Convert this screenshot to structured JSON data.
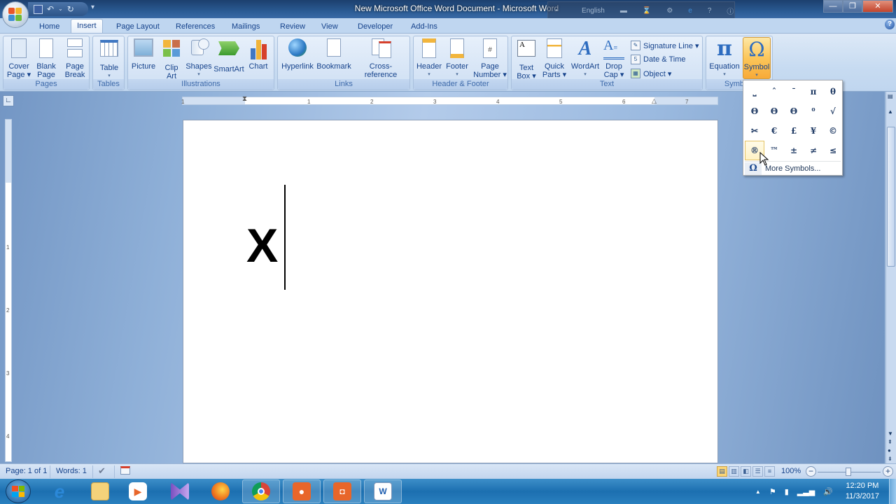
{
  "window": {
    "title": "New Microsoft Office Word Document  -  Microsoft Word",
    "ime_language": "English",
    "controls": {
      "minimize": "—",
      "restore": "❐",
      "close": "✕"
    }
  },
  "qat": {
    "save": "💾",
    "undo": "↶",
    "redo": "↻",
    "customize": "▾"
  },
  "tabs": [
    {
      "label": "Home",
      "active": false
    },
    {
      "label": "Insert",
      "active": true
    },
    {
      "label": "Page Layout",
      "active": false
    },
    {
      "label": "References",
      "active": false
    },
    {
      "label": "Mailings",
      "active": false
    },
    {
      "label": "Review",
      "active": false
    },
    {
      "label": "View",
      "active": false
    },
    {
      "label": "Developer",
      "active": false
    },
    {
      "label": "Add-Ins",
      "active": false
    }
  ],
  "ribbon": {
    "groups": {
      "pages": "Pages",
      "tables": "Tables",
      "illustrations": "Illustrations",
      "links": "Links",
      "header_footer": "Header & Footer",
      "text": "Text",
      "symbols": "Symbols"
    },
    "buttons": {
      "cover_page": [
        "Cover",
        "Page ▾"
      ],
      "blank_page": [
        "Blank",
        "Page"
      ],
      "page_break": [
        "Page",
        "Break"
      ],
      "table": [
        "Table",
        "▾"
      ],
      "picture": [
        "Picture",
        ""
      ],
      "clip_art": [
        "Clip",
        "Art"
      ],
      "shapes": [
        "Shapes",
        "▾"
      ],
      "smartart": [
        "SmartArt",
        ""
      ],
      "chart": [
        "Chart",
        ""
      ],
      "hyperlink": [
        "Hyperlink",
        ""
      ],
      "bookmark": [
        "Bookmark",
        ""
      ],
      "cross_reference": [
        "Cross-reference",
        ""
      ],
      "header": [
        "Header",
        "▾"
      ],
      "footer": [
        "Footer",
        "▾"
      ],
      "page_number": [
        "Page",
        "Number ▾"
      ],
      "text_box": [
        "Text",
        "Box ▾"
      ],
      "quick_parts": [
        "Quick",
        "Parts ▾"
      ],
      "wordart": [
        "WordArt",
        "▾"
      ],
      "drop_cap": [
        "Drop",
        "Cap ▾"
      ],
      "equation": [
        "Equation",
        "▾"
      ],
      "symbol": [
        "Symbol",
        "▾"
      ]
    },
    "small_buttons": {
      "signature_line": "Signature Line ▾",
      "date_time": "Date & Time",
      "object": "Object ▾"
    }
  },
  "symbol_menu": {
    "symbols": [
      "⎵",
      "ˆ",
      "¯",
      "π",
      "θ",
      "Θ",
      "Θ",
      "Θ",
      "⁰",
      "√",
      "✂",
      "€",
      "£",
      "¥",
      "©",
      "®",
      "™",
      "±",
      "≠",
      "≤"
    ],
    "hovered_index": 15,
    "more_icon": "Ω",
    "more_label": "More Symbols..."
  },
  "ruler": {
    "horizontal_labels": [
      "1",
      "1",
      "2",
      "3",
      "4",
      "5",
      "6",
      "7"
    ],
    "vertical_labels": [
      "1",
      "2",
      "3",
      "4"
    ]
  },
  "document": {
    "content": "X"
  },
  "statusbar": {
    "page": "Page: 1 of 1",
    "words": "Words: 1",
    "zoom": "100%",
    "zoom_minus": "−",
    "zoom_plus": "+"
  },
  "taskbar": {
    "clock_time": "12:20 PM",
    "clock_date": "11/3/2017",
    "tray_arrow": "▲",
    "apps": [
      "Internet Explorer",
      "File Explorer",
      "Media Player",
      "Visual Studio",
      "Firefox",
      "Chrome",
      "Screen Recorder",
      "Screenshot Tool",
      "Microsoft Word"
    ]
  }
}
